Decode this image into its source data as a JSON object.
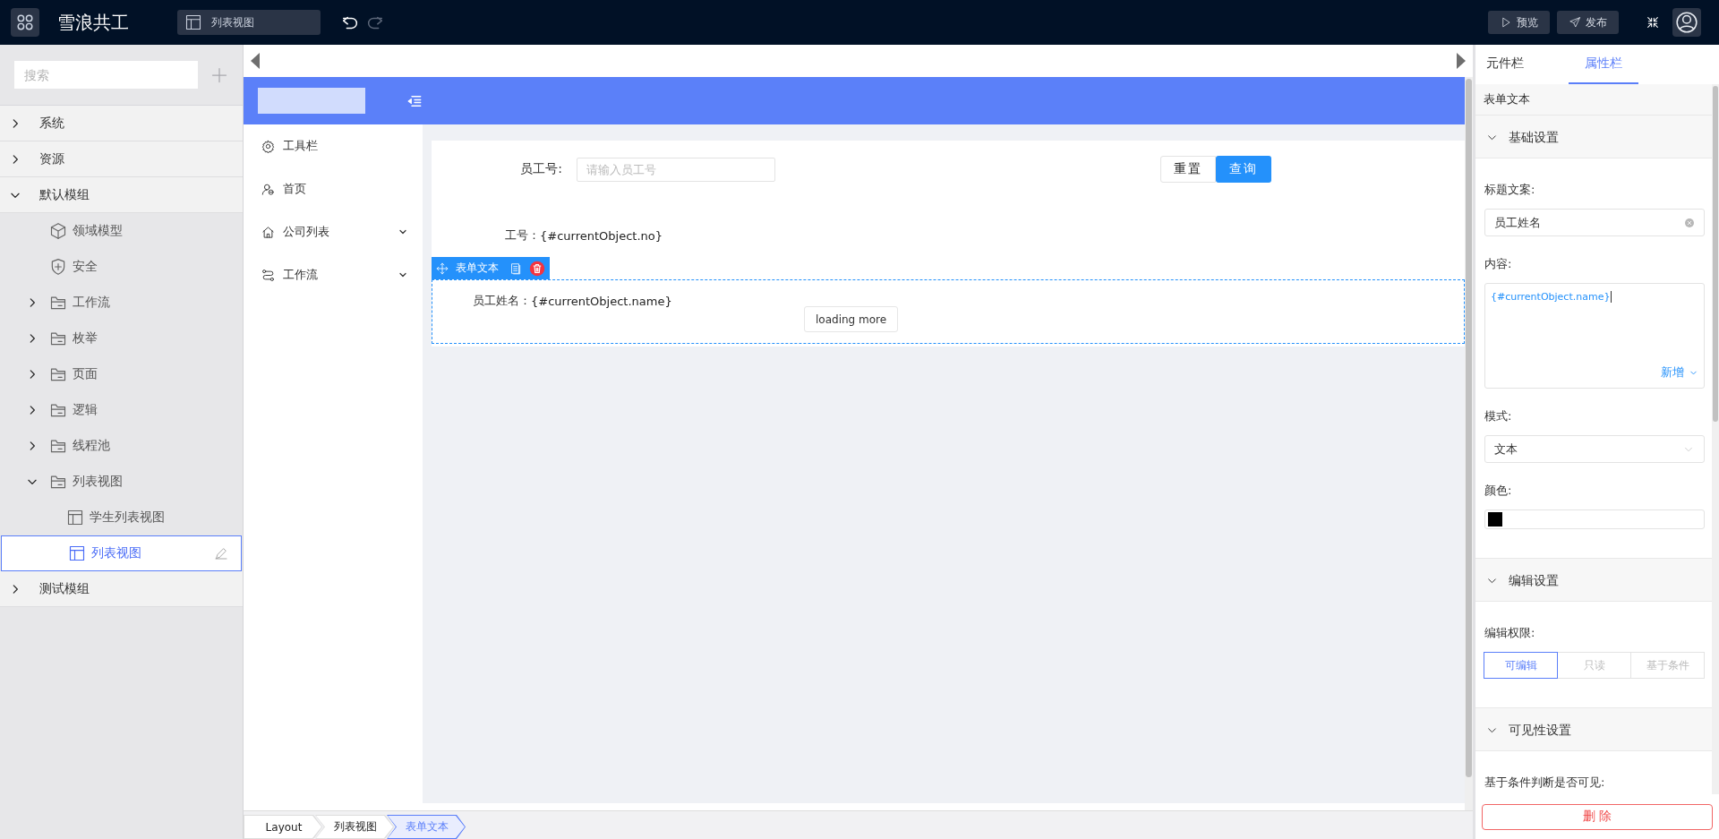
{
  "topbar": {
    "app_title": "雪浪共工",
    "page_tab": "列表视图",
    "actions": [
      {
        "label": "预览",
        "kind": "preview"
      },
      {
        "label": "发布",
        "kind": "publish"
      }
    ]
  },
  "sidebar": {
    "search_placeholder": "搜索",
    "tree": [
      {
        "label": "系统",
        "kind": "module",
        "expanded": false,
        "selected": false
      },
      {
        "label": "资源",
        "kind": "module",
        "expanded": false,
        "selected": false
      },
      {
        "label": "默认模组",
        "kind": "module",
        "expanded": true,
        "selected": false,
        "children": [
          {
            "label": "领域模型",
            "kind": "model",
            "selected": false
          },
          {
            "label": "安全",
            "kind": "security",
            "selected": false
          },
          {
            "label": "工作流",
            "kind": "folder",
            "expanded": false,
            "selected": false
          },
          {
            "label": "枚举",
            "kind": "folder",
            "expanded": false,
            "selected": false
          },
          {
            "label": "页面",
            "kind": "folder",
            "expanded": false,
            "selected": false
          },
          {
            "label": "逻辑",
            "kind": "folder",
            "expanded": false,
            "selected": false
          },
          {
            "label": "线程池",
            "kind": "folder",
            "expanded": false,
            "selected": false
          },
          {
            "label": "列表视图",
            "kind": "folder",
            "expanded": true,
            "selected": false,
            "children": [
              {
                "label": "学生列表视图",
                "kind": "view",
                "selected": false
              },
              {
                "label": "列表视图",
                "kind": "view",
                "selected": true
              }
            ]
          }
        ]
      },
      {
        "label": "测试模组",
        "kind": "module",
        "expanded": false,
        "selected": false
      }
    ]
  },
  "canvas": {
    "nav": [
      {
        "label": "工具栏",
        "kind": "settings",
        "has_submenu": false
      },
      {
        "label": "首页",
        "kind": "user",
        "has_submenu": false
      },
      {
        "label": "公司列表",
        "kind": "home",
        "has_submenu": true
      },
      {
        "label": "工作流",
        "kind": "flow",
        "has_submenu": true
      }
    ],
    "query": {
      "label": "员工号:",
      "placeholder": "请输入员工号",
      "buttons": [
        {
          "label": "重置",
          "kind": "default"
        },
        {
          "label": "查询",
          "kind": "primary"
        }
      ]
    },
    "fields": [
      {
        "label": "工号：",
        "value": "{#currentObject.no}",
        "selected": false
      },
      {
        "label": "员工姓名：",
        "value": "{#currentObject.name}",
        "selected": true,
        "toolbar_label": "表单文本",
        "button": "loading more"
      }
    ]
  },
  "breadcrumb": [
    {
      "label": "Layout",
      "selected": false
    },
    {
      "label": "列表视图",
      "selected": false
    },
    {
      "label": "表单文本",
      "selected": true
    }
  ],
  "properties": {
    "tabs": [
      {
        "label": "元件栏",
        "selected": false
      },
      {
        "label": "属性栏",
        "selected": true
      }
    ],
    "component": "表单文本",
    "sections": [
      {
        "title": "基础设置",
        "expanded": true,
        "fields": [
          {
            "kind": "text",
            "label": "标题文案:",
            "value": "员工姓名"
          },
          {
            "kind": "textarea",
            "label": "内容:",
            "value": "{#currentObject.name}",
            "action": "新增"
          },
          {
            "kind": "select",
            "label": "模式:",
            "value": "文本"
          },
          {
            "kind": "color",
            "label": "颜色:",
            "color": "#000000"
          }
        ]
      },
      {
        "title": "编辑设置",
        "expanded": true,
        "fields": [
          {
            "kind": "segmented",
            "label": "编辑权限:",
            "options": [
              {
                "label": "可编辑",
                "selected": true
              },
              {
                "label": "只读",
                "selected": false
              },
              {
                "label": "基于条件",
                "selected": false
              }
            ]
          }
        ]
      },
      {
        "title": "可见性设置",
        "expanded": true,
        "fields": [
          {
            "kind": "label",
            "label": "基于条件判断是否可见:"
          }
        ]
      }
    ],
    "delete_label": "删 除"
  }
}
